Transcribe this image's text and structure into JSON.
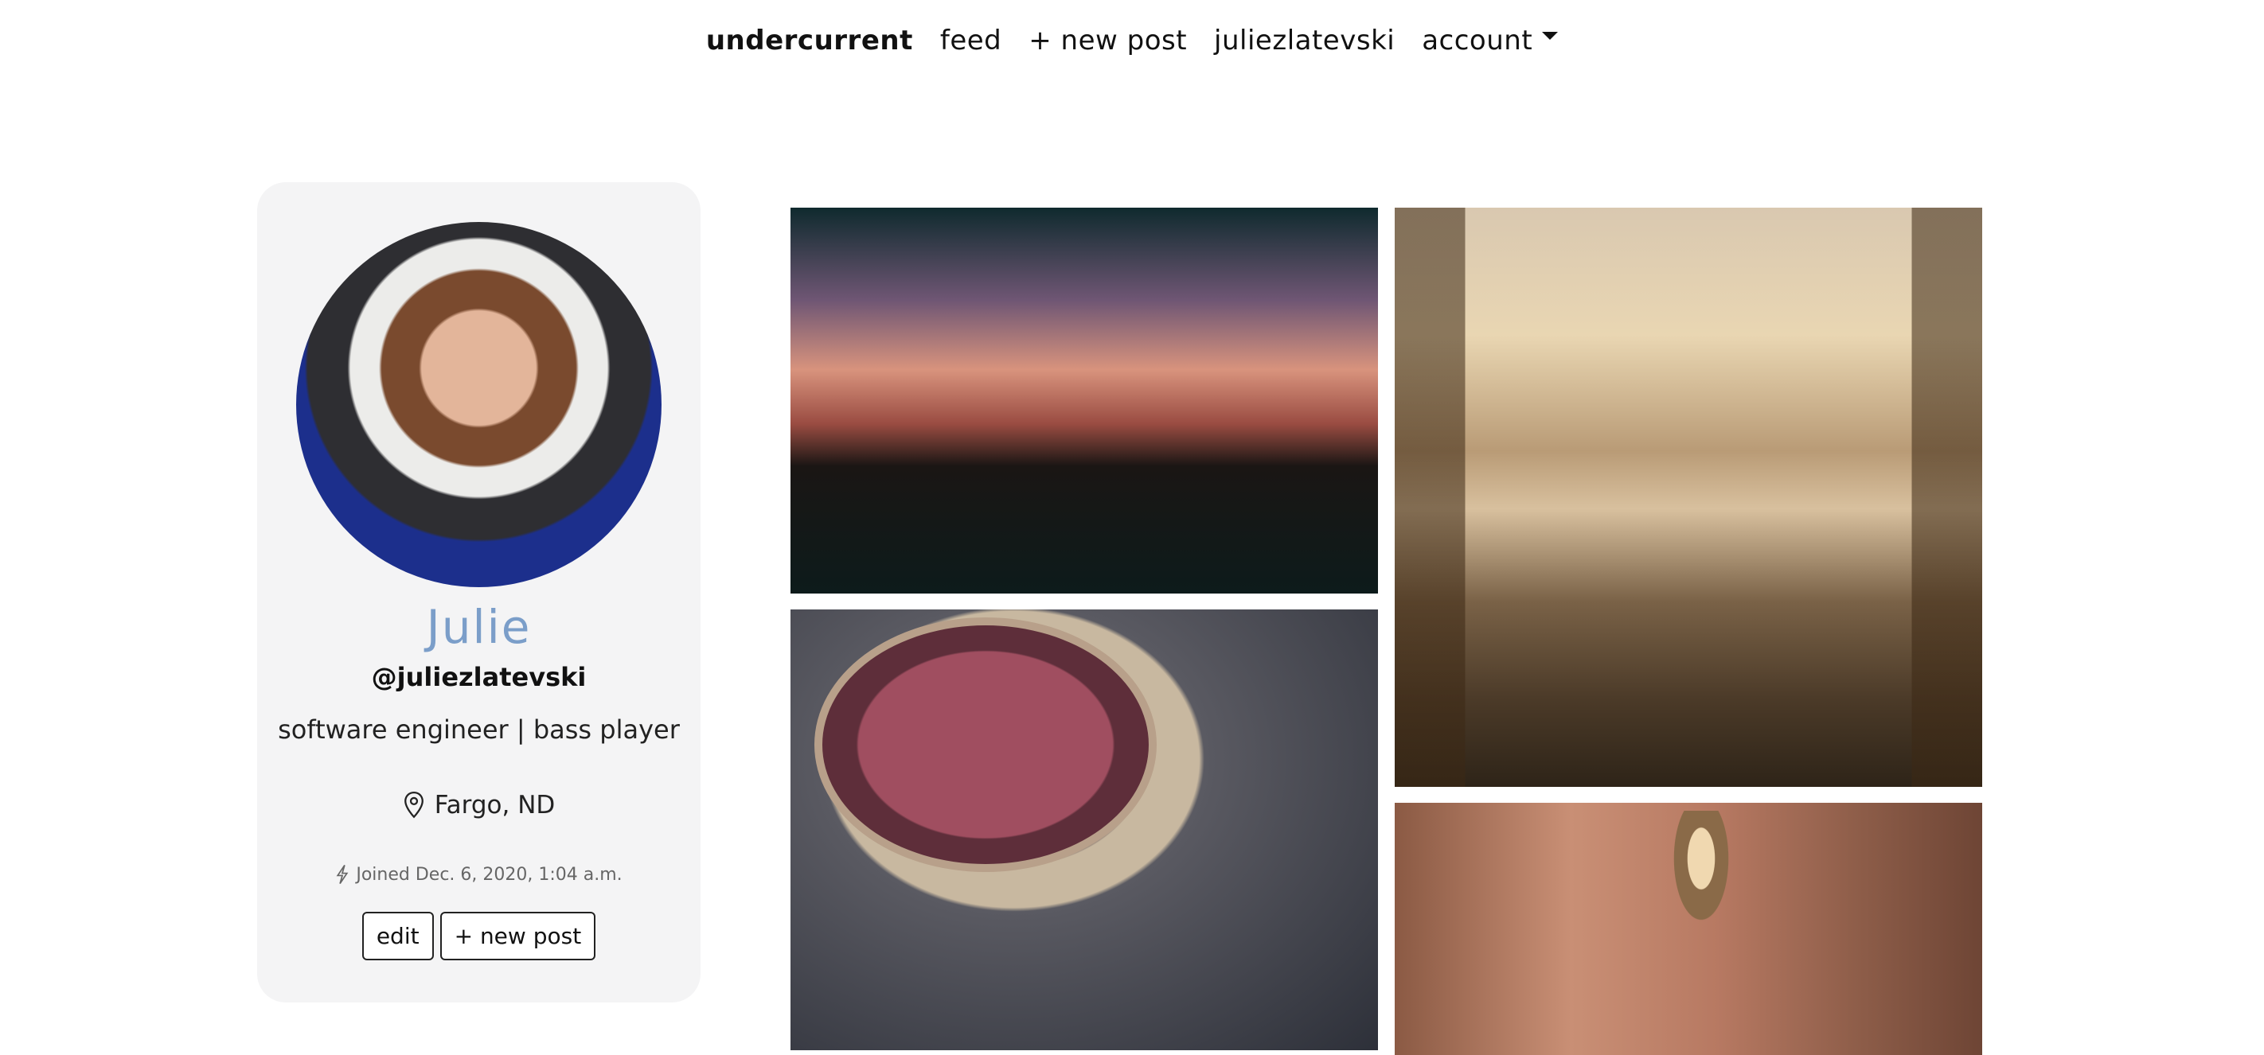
{
  "nav": {
    "brand": "undercurrent",
    "feed": "feed",
    "new_post": "+ new post",
    "user": "juliezlatevski",
    "account": "account"
  },
  "profile": {
    "name": "Julie",
    "handle": "@juliezlatevski",
    "bio": "software engineer | bass player",
    "location": "Fargo, ND",
    "joined": "Joined Dec. 6, 2020, 1:04 a.m.",
    "edit_label": "edit",
    "new_post_label": "+ new post"
  },
  "photos": [
    {
      "subject": "sunset street view through car windshield"
    },
    {
      "subject": "sunlit curtains over bed facing sea"
    },
    {
      "subject": "teacup with tea on gilded saucer"
    },
    {
      "subject": "lamp-lit arched hallway"
    }
  ],
  "colors": {
    "accent_name": "#7b9ec9",
    "card_bg": "#f4f4f5"
  }
}
